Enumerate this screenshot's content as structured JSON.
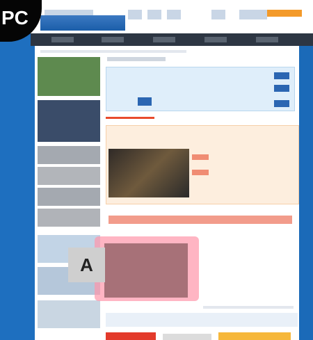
{
  "corner_tab": {
    "label": "PC",
    "icon": "monitor-icon"
  },
  "overlay": {
    "label": "A",
    "highlight_color": "#ff96aa"
  },
  "colors": {
    "frame_blue": "#1e6fbf",
    "nav_dark": "#2d3643",
    "accent_orange": "#f39a2a",
    "cta_red": "#e33a2b",
    "cta_yellow": "#f6b73a",
    "link_blue": "#2b66b2"
  }
}
